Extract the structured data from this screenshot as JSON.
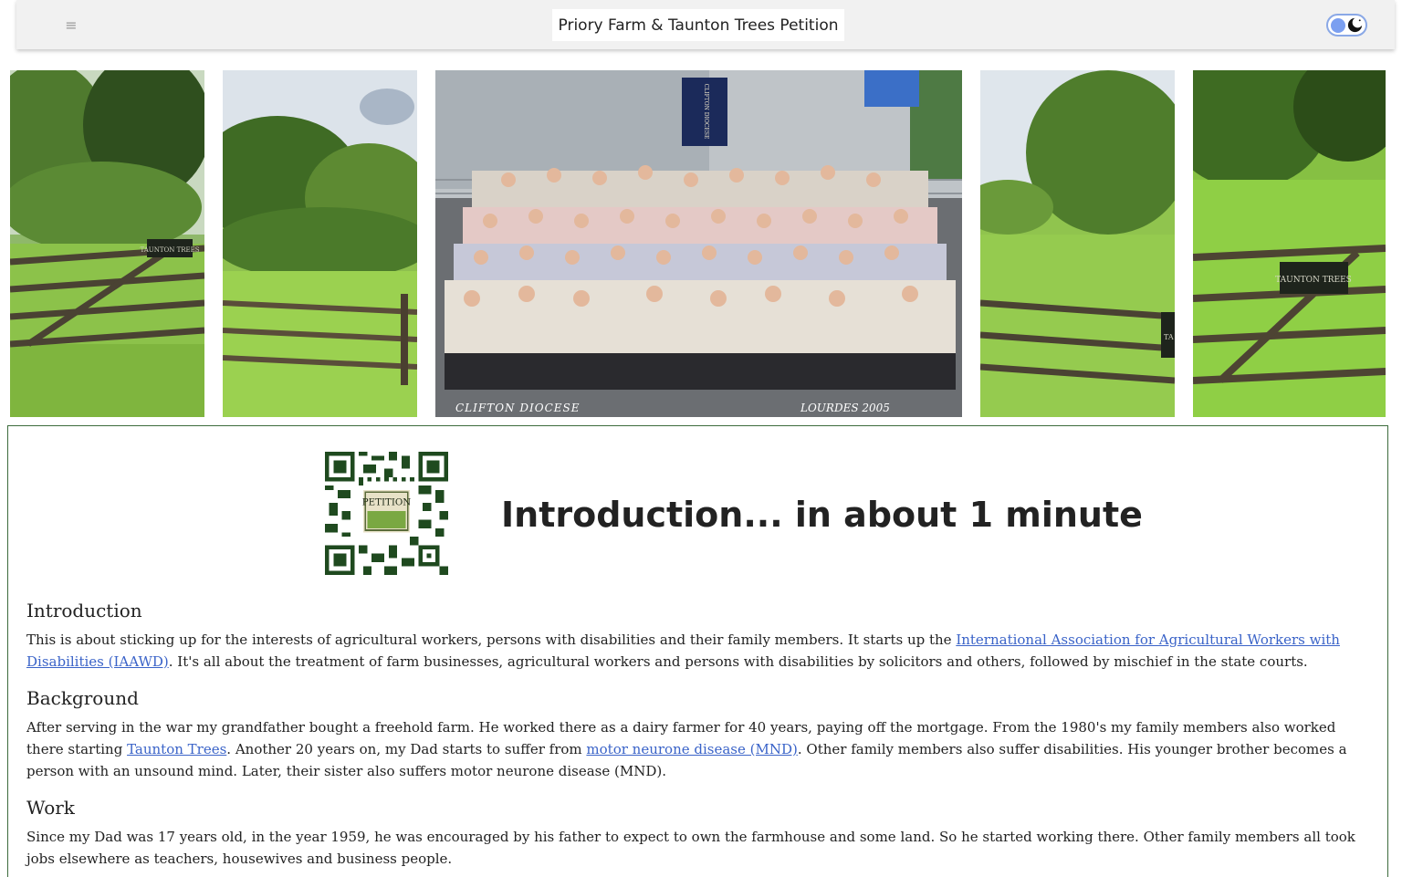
{
  "header": {
    "menu_icon": "hamburger-icon",
    "title": "Priory Farm & Taunton Trees Petition",
    "theme_toggle_icon": "moon-icon"
  },
  "gallery": {
    "photos": [
      {
        "sign_text": "TAUNTON TREES"
      },
      {
        "sign_text": ""
      },
      {
        "caption_left": "CLIFTON DIOCESE",
        "caption_right": "LOURDES 2005",
        "banner_text": "CLIFTON DIOCESE"
      },
      {
        "sign_text": "TA"
      },
      {
        "sign_text": "TAUNTON TREES"
      }
    ]
  },
  "main": {
    "qr_label": "PETITION",
    "heading": "Introduction... in about 1 minute",
    "sections": [
      {
        "title": "Introduction",
        "text1": "This is about sticking up for the interests of agricultural workers, persons with disabilities and their family members. It starts up the ",
        "link1": "International Association for Agricultural Workers with Disabilities (IAAWD)",
        "text2": ". It's all about the treatment of farm businesses, agricultural workers and persons with disabilities by solicitors and others, followed by mischief in the state courts."
      },
      {
        "title": "Background",
        "text1": "After serving in the war my grandfather bought a freehold farm. He worked there as a dairy farmer for 40 years, paying off the mortgage. From the 1980's my family members also worked there starting ",
        "link1": "Taunton Trees",
        "text2": ". Another 20 years on, my Dad starts to suffer from ",
        "link2": "motor neurone disease (MND)",
        "text3": ". Other family members also suffer disabilities. His younger brother becomes a person with an unsound mind. Later, their sister also suffers motor neurone disease (MND)."
      },
      {
        "title": "Work",
        "text1": "Since my Dad was 17 years old, in the year 1959, he was encouraged by his father to expect to own the farmhouse and some land. So he started working there. Other family members all took jobs elsewhere as teachers, housewives and business people."
      }
    ]
  }
}
